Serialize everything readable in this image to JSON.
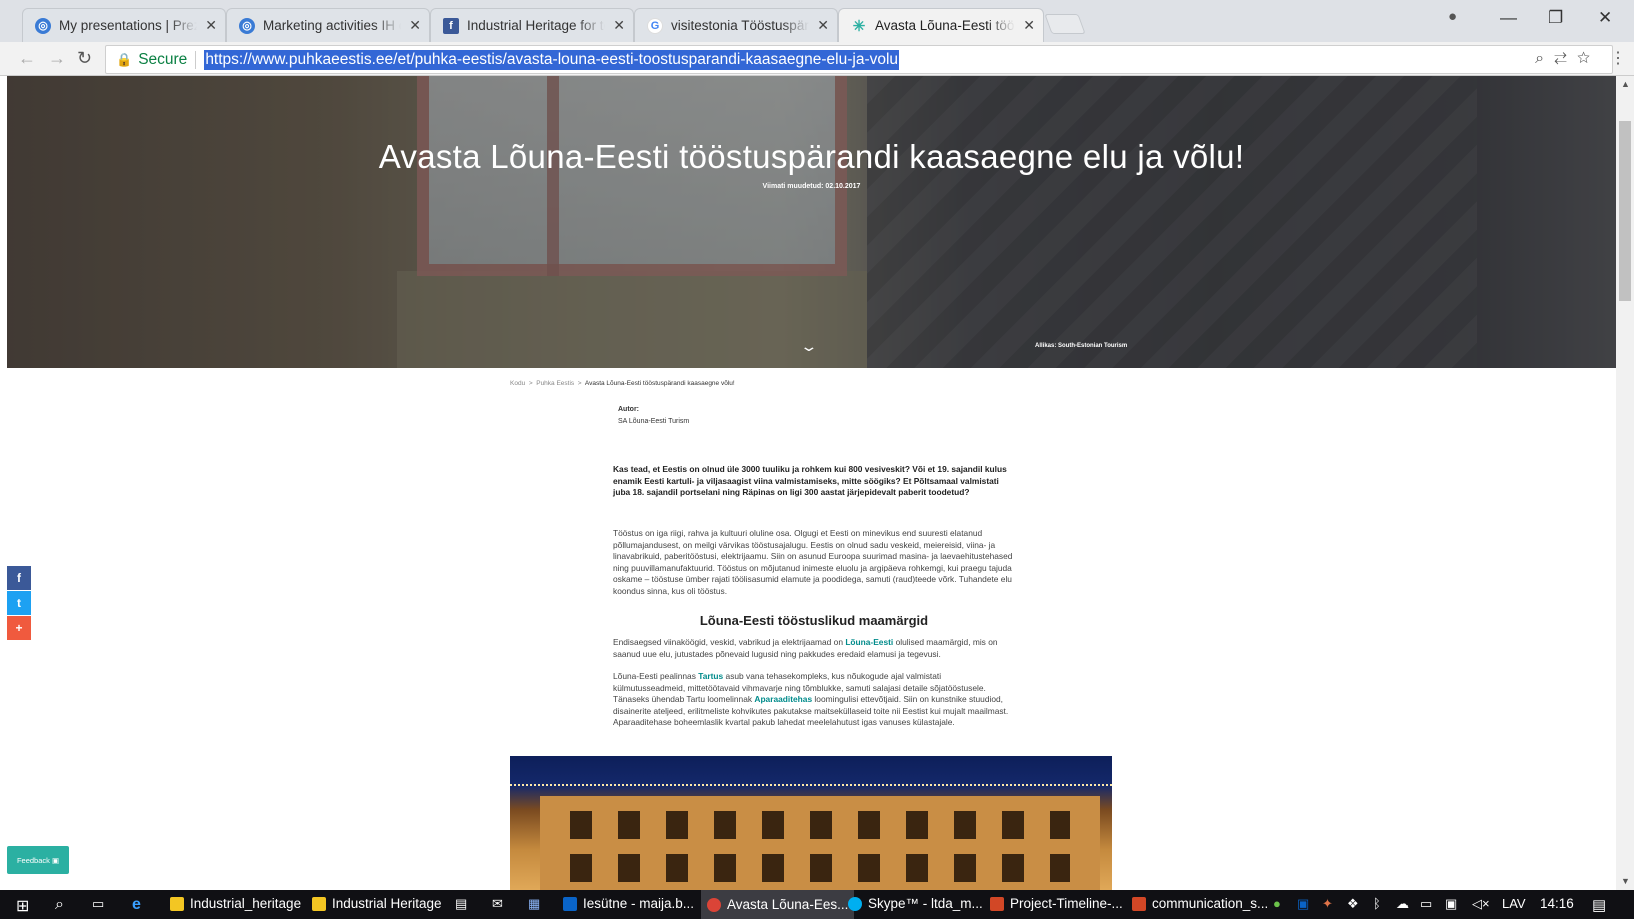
{
  "browser": {
    "tabs": [
      {
        "title": "My presentations | Prezi",
        "favicon": "prezi-icon",
        "color": "#3a7bd5"
      },
      {
        "title": "Marketing activities IH or",
        "favicon": "prezi-icon",
        "color": "#3a7bd5"
      },
      {
        "title": "Industrial Heritage for to",
        "favicon": "facebook-icon",
        "color": "#3b5998"
      },
      {
        "title": "visitestonia Tööstuspäran",
        "favicon": "google-icon",
        "color": "#4285f4"
      },
      {
        "title": "Avasta Lõuna-Eesti tööst",
        "favicon": "puhka-eestis-icon",
        "color": "#2bb0a2"
      }
    ],
    "active_tab_index": 4,
    "secure_label": "Secure",
    "url": "https://www.puhkaeestis.ee/et/puhka-eestis/avasta-louna-eesti-toostusparandi-kaasaegne-elu-ja-volu"
  },
  "page": {
    "hero": {
      "title": "Avasta Lõuna-Eesti tööstuspärandi kaasaegne elu ja võlu!",
      "updated": "Viimati muudetud: 02.10.2017",
      "photo_credit": "Allikas: South-Estonian Tourism"
    },
    "breadcrumb": {
      "home": "Kodu",
      "section": "Puhka Eestis",
      "current": "Avasta Lõuna-Eesti tööstuspärandi kaasaegne võlu!",
      "separator": ">"
    },
    "author": {
      "label": "Autor:",
      "name": "SA Lõuna-Eesti Turism"
    },
    "lead": "Kas tead, et Eestis on olnud üle 3000 tuuliku ja rohkem kui 800 vesiveskit? Või et 19. sajandil kulus enamik Eesti kartuli- ja viljasaagist viina valmistamiseks, mitte söögiks? Et Põltsamaal valmistati juba 18. sajandil portselani ning Räpinas on ligi 300 aastat järjepidevalt paberit toodetud?",
    "paragraph1": "Tööstus on iga riigi, rahva ja kultuuri oluline osa. Olgugi et Eesti on minevikus end suuresti elatanud põllumajandusest, on meilgi värvikas tööstusajalugu. Eestis on olnud sadu veskeid, meiereisid, viina- ja linavabrikuid, paberitööstusi, elektrijaamu. Siin on asunud Euroopa suurimad masina- ja laevaehitustehased ning puuvillamanufaktuurid. Tööstus on mõjutanud inimeste eluolu ja argipäeva rohkemgi, kui praegu tajuda oskame – tööstuse ümber rajati töölisasumid elamute ja poodidega, samuti (raud)teede võrk. Tuhandete elu koondus sinna, kus oli tööstus.",
    "heading": "Lõuna-Eesti tööstuslikud maamärgid",
    "paragraph2": {
      "before": "Endisaegsed viinaköögid, veskid, vabrikud ja elektrijaamad on ",
      "link": "Lõuna-Eesti",
      "after": " olulised maamärgid, mis on saanud uue elu, jutustades põnevaid lugusid ning pakkudes eredaid elamusi ja tegevusi."
    },
    "paragraph3": {
      "part1": "Lõuna-Eesti pealinnas ",
      "link1": "Tartus",
      "part2": " asub vana tehasekompleks, kus nõukogude ajal valmistati külmutusseadmeid, mittetöötavaid vihmavarje ning tõmblukke, samuti salajasi detaile sõjatööstusele. Tänaseks ühendab Tartu loomelinnak ",
      "link2": "Aparaaditehas",
      "part3": " loomingulisi ettevõtjaid. Siin on kunstnike stuudiod, disainerite ateljeed, erilitmeliste kohvikutes pakutakse maitseküllaseid toite nii Eestist kui mujalt maailmast. Aparaaditehase boheemlaslik kvartal pakub lahedat meelelahutust igas vanuses külastajale."
    },
    "social": {
      "facebook": "f",
      "twitter": "t",
      "more": "+"
    },
    "feedback_label": "Feedback"
  },
  "taskbar": {
    "items": [
      {
        "label": "Industrial_heritage",
        "icon": "folder-icon",
        "color": "#f3c623"
      },
      {
        "label": "Industrial Heritage",
        "icon": "folder-icon",
        "color": "#f3c623"
      },
      {
        "label": "Iesütne - maija.b...",
        "icon": "outlook-icon",
        "color": "#0a64c8"
      },
      {
        "label": "Avasta Lõuna-Ees...",
        "icon": "chrome-icon",
        "color": "#db4437"
      },
      {
        "label": "Skype™ - ltda_m...",
        "icon": "skype-icon",
        "color": "#00aff0"
      },
      {
        "label": "Project-Timeline-...",
        "icon": "powerpoint-icon",
        "color": "#d24726"
      },
      {
        "label": "communication_s...",
        "icon": "powerpoint-icon",
        "color": "#d24726"
      }
    ],
    "language": "LAV",
    "time": "14:16"
  }
}
